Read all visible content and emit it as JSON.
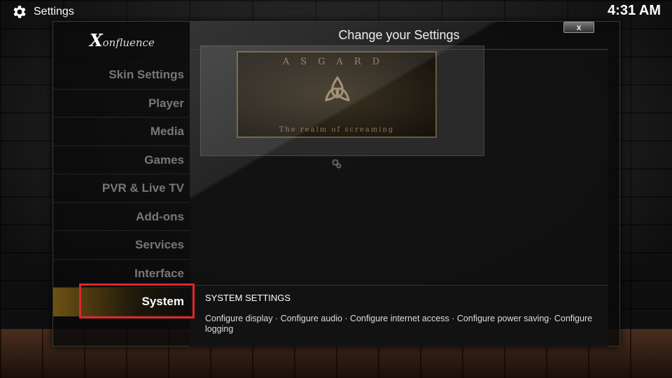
{
  "topbar": {
    "title": "Settings",
    "clock": "4:31 AM",
    "settings_icon": "gear-icon"
  },
  "logo": {
    "initial": "X",
    "rest": "onfluence"
  },
  "close_label": "x",
  "header": {
    "title": "Change your Settings"
  },
  "preview": {
    "top_text": "ASGARD",
    "bottom_text": "The realm of screaming"
  },
  "menu": {
    "items": [
      {
        "label": "Skin Settings"
      },
      {
        "label": "Player"
      },
      {
        "label": "Media"
      },
      {
        "label": "Games"
      },
      {
        "label": "PVR & Live TV"
      },
      {
        "label": "Add-ons"
      },
      {
        "label": "Services"
      },
      {
        "label": "Interface"
      },
      {
        "label": "System"
      }
    ],
    "selected": "System"
  },
  "description": {
    "title": "SYSTEM SETTINGS",
    "body": "Configure display · Configure audio · Configure internet access · Configure power saving· Configure logging"
  },
  "colors": {
    "highlight_border": "#e0262a",
    "active_item_accent": "#785a14"
  }
}
